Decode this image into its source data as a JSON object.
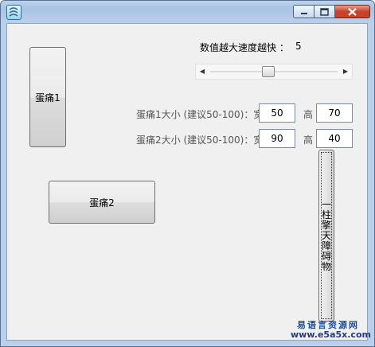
{
  "window": {
    "icon": "app-icon",
    "buttons": {
      "minimize": "minimize-icon",
      "maximize": "maximize-icon",
      "close": "close-icon"
    }
  },
  "egg1": {
    "label": "蛋痛1"
  },
  "egg2": {
    "label": "蛋痛2"
  },
  "speed": {
    "label": "数值越大速度越快 ：",
    "value": "5"
  },
  "slider": {
    "left_arrow": "◀",
    "right_arrow": "▶",
    "level": 0.45
  },
  "egg1_size": {
    "label": "蛋痛1大小 (建议50-100)：宽",
    "width": "50",
    "height_label": "高",
    "height": "70"
  },
  "egg2_size": {
    "label": "蛋痛2大小 (建议50-100)：宽",
    "width": "90",
    "height_label": "高",
    "height": "40"
  },
  "wall": {
    "label": "一柱擎天障碍物"
  },
  "watermark": {
    "line1": "易语言资源网",
    "line2": "www.e5a5x.com"
  }
}
